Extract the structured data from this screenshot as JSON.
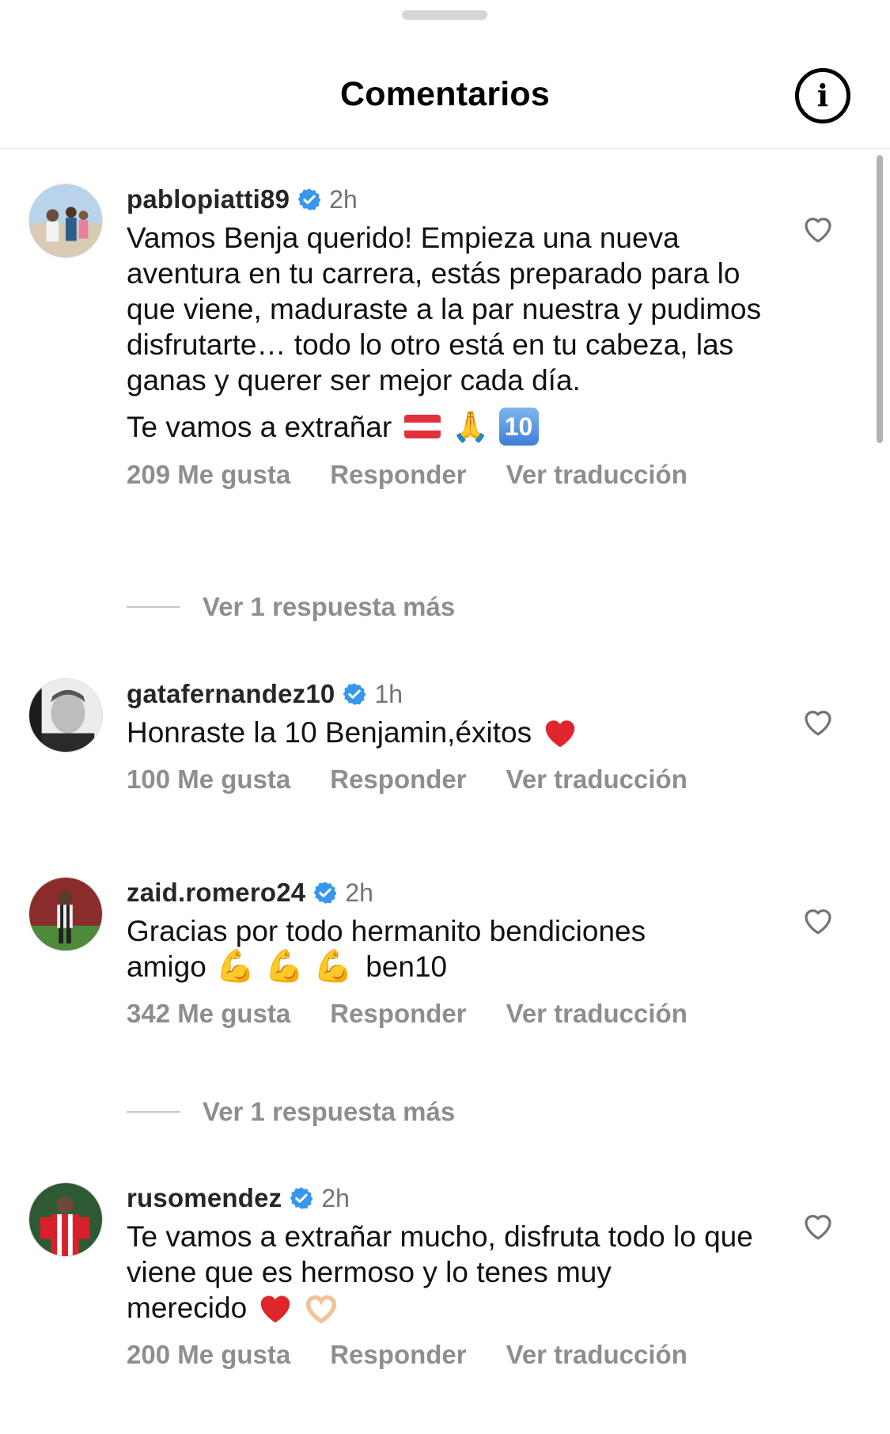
{
  "header": {
    "title": "Comentarios",
    "info_icon": "info-icon"
  },
  "colors": {
    "verified": "#3797f0",
    "muted": "#8e8e8e",
    "heart_red": "#e0262d"
  },
  "comments": [
    {
      "username": "pablopiatti89",
      "time": "2h",
      "text": "Vamos Benja querido! Empieza una nueva aventura en tu carrera, estás preparado para lo que viene, maduraste a la par nuestra y pudimos disfrutarte… todo lo otro está en tu cabeza, las ganas y querer ser mejor cada día.",
      "text2": "Te vamos a extrañar",
      "likes": "209 Me gusta",
      "reply": "Responder",
      "translate": "Ver traducción",
      "more_replies": "Ver 1 respuesta más"
    },
    {
      "username": "gatafernandez10",
      "time": "1h",
      "text": "Honraste la 10 Benjamin,éxitos",
      "likes": "100 Me gusta",
      "reply": "Responder",
      "translate": "Ver traducción"
    },
    {
      "username": "zaid.romero24",
      "time": "2h",
      "text": "Gracias por todo hermanito bendiciones",
      "text_line2_a": "amigo",
      "text_line2_b": "ben10",
      "likes": "342 Me gusta",
      "reply": "Responder",
      "translate": "Ver traducción",
      "more_replies": "Ver 1 respuesta más"
    },
    {
      "username": "rusomendez",
      "time": "2h",
      "text": "Te vamos a extrañar mucho, disfruta todo lo que viene que es hermoso y lo tenes muy",
      "text_last": "merecido",
      "likes": "200 Me gusta",
      "reply": "Responder",
      "translate": "Ver traducción"
    }
  ]
}
